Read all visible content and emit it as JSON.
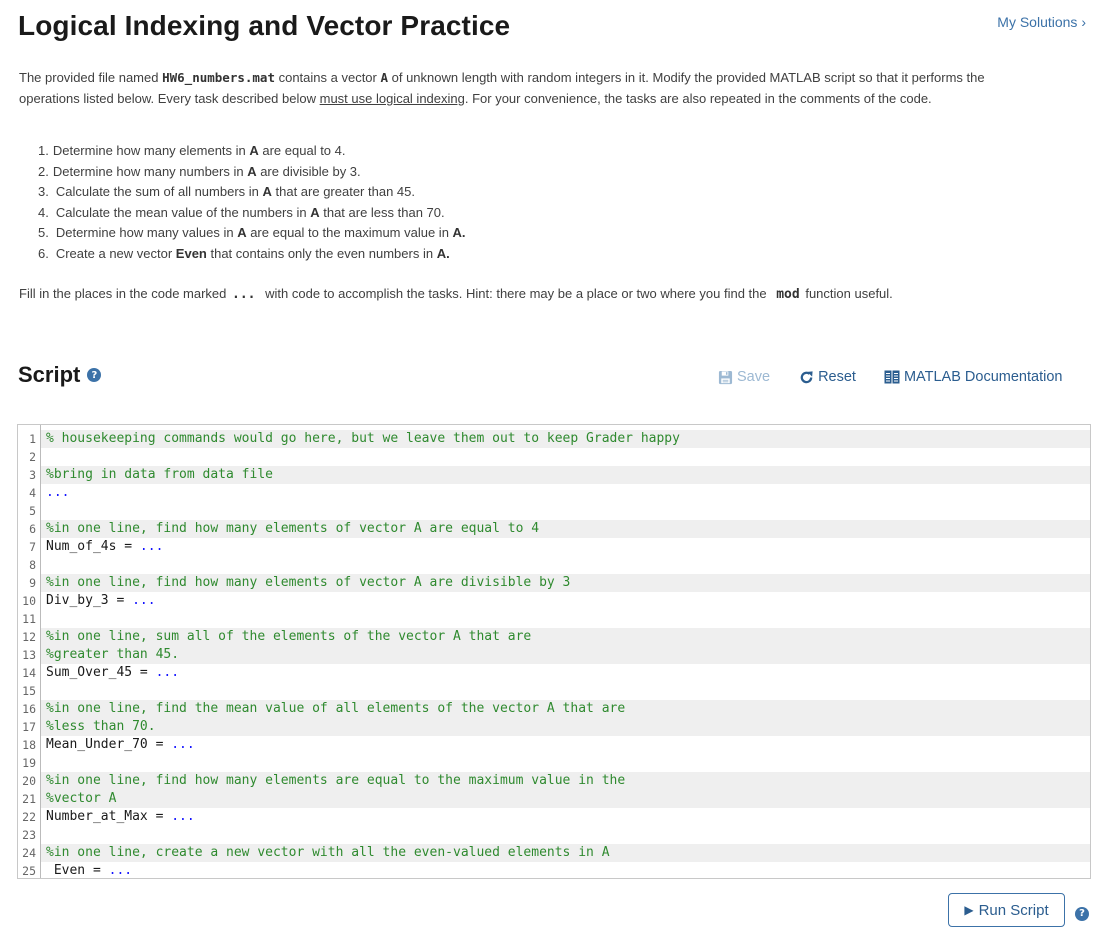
{
  "header": {
    "title": "Logical Indexing and Vector Practice",
    "my_solutions_label": "My Solutions",
    "my_solutions_chevron": "›"
  },
  "description": {
    "p1_a": "The provided file named ",
    "p1_file": "HW6_numbers.mat",
    "p1_b": " contains a vector ",
    "p1_var": "A",
    "p1_c": "  of unknown length with random integers in it.  Modify the provided MATLAB script so that it performs the operations listed below.  Every task described below ",
    "p1_underline": "must use logical indexing",
    "p1_d": ". For your convenience, the tasks are also repeated in the comments of the code."
  },
  "tasks": [
    {
      "num": "1.",
      "pre": "Determine how many elements in ",
      "bold": "A",
      "post": " are equal to 4.",
      "bold2": ""
    },
    {
      "num": "2.",
      "pre": "Determine how many numbers in ",
      "bold": "A",
      "post": " are divisible by 3.",
      "bold2": ""
    },
    {
      "num": "3.",
      "pre": "Calculate the sum of all numbers in ",
      "bold": "A",
      "post": " that are greater than 45.",
      "bold2": ""
    },
    {
      "num": "4.",
      "pre": "Calculate the mean value of the numbers in ",
      "bold": "A",
      "post": " that are less than 70.",
      "bold2": ""
    },
    {
      "num": "5.",
      "pre": "Determine how many values in ",
      "bold": "A",
      "post": " are equal to the maximum value in ",
      "bold2": "A."
    },
    {
      "num": "6.",
      "pre": "Create a new vector ",
      "bold": "Even",
      "post": " that contains only the even numbers in ",
      "bold2": "A."
    }
  ],
  "fill_hint": {
    "a": "Fill in the places in the code marked",
    "dots": "...",
    "b": "with code to accomplish the tasks.  Hint: there may be a place or two where you find the",
    "mod": "mod",
    "c": "function useful."
  },
  "script": {
    "title": "Script",
    "help_glyph": "?",
    "toolbar": {
      "save_label": "Save",
      "reset_label": "Reset",
      "docs_label": "MATLAB Documentation"
    }
  },
  "code_lines": [
    {
      "n": "1",
      "type": "comment",
      "text": "% housekeeping commands would go here, but we leave them out to keep Grader happy",
      "dots": ""
    },
    {
      "n": "2",
      "type": "blank",
      "text": "",
      "dots": ""
    },
    {
      "n": "3",
      "type": "comment",
      "text": "%bring in data from data file",
      "dots": ""
    },
    {
      "n": "4",
      "type": "code",
      "text": "",
      "dots": "..."
    },
    {
      "n": "5",
      "type": "blank",
      "text": "",
      "dots": ""
    },
    {
      "n": "6",
      "type": "comment",
      "text": "%in one line, find how many elements of vector A are equal to 4",
      "dots": ""
    },
    {
      "n": "7",
      "type": "code",
      "text": "Num_of_4s = ",
      "dots": "..."
    },
    {
      "n": "8",
      "type": "blank",
      "text": "",
      "dots": ""
    },
    {
      "n": "9",
      "type": "comment",
      "text": "%in one line, find how many elements of vector A are divisible by 3",
      "dots": ""
    },
    {
      "n": "10",
      "type": "code",
      "text": "Div_by_3 = ",
      "dots": "..."
    },
    {
      "n": "11",
      "type": "blank",
      "text": "",
      "dots": ""
    },
    {
      "n": "12",
      "type": "comment",
      "text": "%in one line, sum all of the elements of the vector A that are",
      "dots": ""
    },
    {
      "n": "13",
      "type": "comment",
      "text": "%greater than 45.",
      "dots": ""
    },
    {
      "n": "14",
      "type": "code",
      "text": "Sum_Over_45 = ",
      "dots": "..."
    },
    {
      "n": "15",
      "type": "blank",
      "text": "",
      "dots": ""
    },
    {
      "n": "16",
      "type": "comment",
      "text": "%in one line, find the mean value of all elements of the vector A that are",
      "dots": ""
    },
    {
      "n": "17",
      "type": "comment",
      "text": "%less than 70.",
      "dots": ""
    },
    {
      "n": "18",
      "type": "code",
      "text": "Mean_Under_70 = ",
      "dots": "..."
    },
    {
      "n": "19",
      "type": "blank",
      "text": "",
      "dots": ""
    },
    {
      "n": "20",
      "type": "comment",
      "text": "%in one line, find how many elements are equal to the maximum value in the",
      "dots": ""
    },
    {
      "n": "21",
      "type": "comment",
      "text": "%vector A",
      "dots": ""
    },
    {
      "n": "22",
      "type": "code",
      "text": "Number_at_Max = ",
      "dots": "..."
    },
    {
      "n": "23",
      "type": "blank",
      "text": "",
      "dots": ""
    },
    {
      "n": "24",
      "type": "comment",
      "text": "%in one line, create a new vector with all the even-valued elements in A",
      "dots": ""
    },
    {
      "n": "25",
      "type": "code",
      "text": " Even = ",
      "dots": "..."
    }
  ],
  "footer": {
    "run_label": "Run Script",
    "help_glyph": "?"
  },
  "colors": {
    "accent": "#3c72a8",
    "comment": "#2f8a2f",
    "ellipsis": "#1414ff",
    "comment_bg": "#efefef"
  }
}
